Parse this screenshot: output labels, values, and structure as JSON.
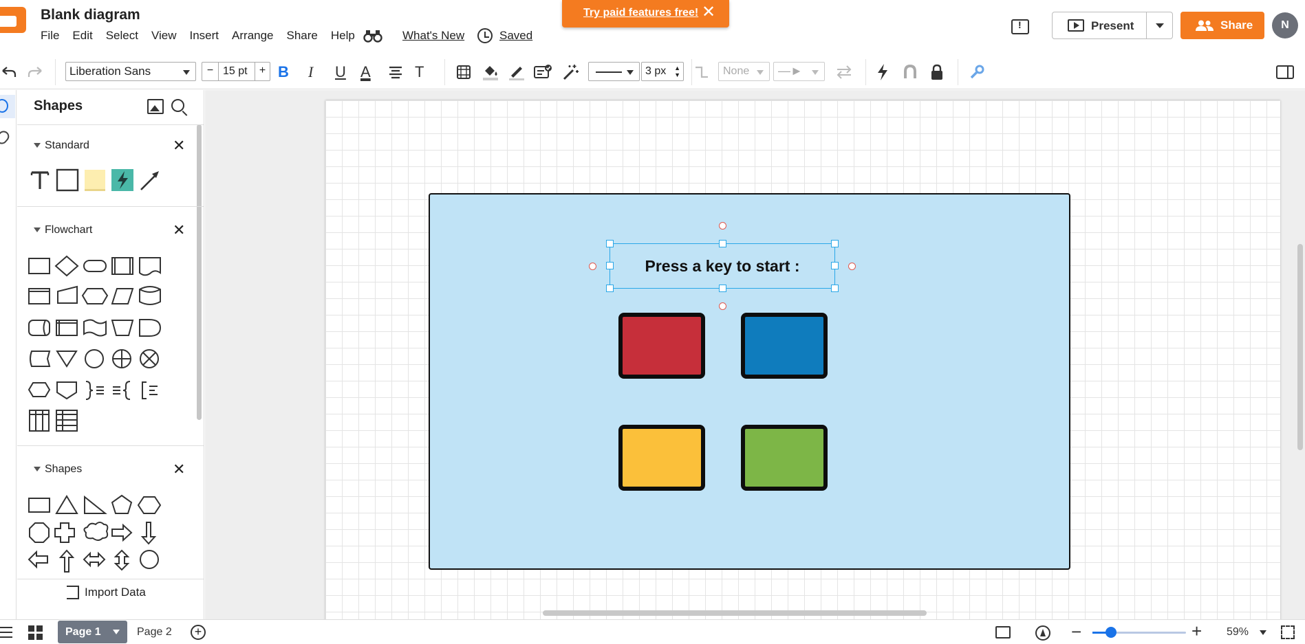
{
  "app": {
    "doc_title": "Blank diagram",
    "menus": [
      "File",
      "Edit",
      "Select",
      "View",
      "Insert",
      "Arrange",
      "Share",
      "Help"
    ],
    "whats_new": "What's New",
    "saved": "Saved",
    "promo_text": "Try paid features free!",
    "present_label": "Present",
    "share_label": "Share",
    "avatar_initial": "N",
    "accent": "#f47b20"
  },
  "toolbar": {
    "font_family": "Liberation Sans",
    "font_size": "15 pt",
    "bold": "B",
    "italic": "I",
    "underline": "U",
    "font_color_letter": "A",
    "text_options": "T",
    "line_width": "3 px",
    "endpoint_none": "None"
  },
  "shapes_panel": {
    "title": "Shapes",
    "sections": [
      {
        "title": "Standard"
      },
      {
        "title": "Flowchart"
      },
      {
        "title": "Shapes"
      }
    ],
    "import_label": "Import Data"
  },
  "canvas": {
    "prompt_text": "Press a key to start :",
    "board_color": "#c0e3f6",
    "tiles": [
      {
        "name": "red-tile",
        "color": "#c62f3a"
      },
      {
        "name": "blue-tile",
        "color": "#0f7cbd"
      },
      {
        "name": "yellow-tile",
        "color": "#fbc03a"
      },
      {
        "name": "green-tile",
        "color": "#7db647"
      }
    ]
  },
  "bottombar": {
    "pages": [
      "Page 1",
      "Page 2"
    ],
    "active_page": "Page 1",
    "zoom": "59%",
    "zoom_fraction": 0.2
  }
}
